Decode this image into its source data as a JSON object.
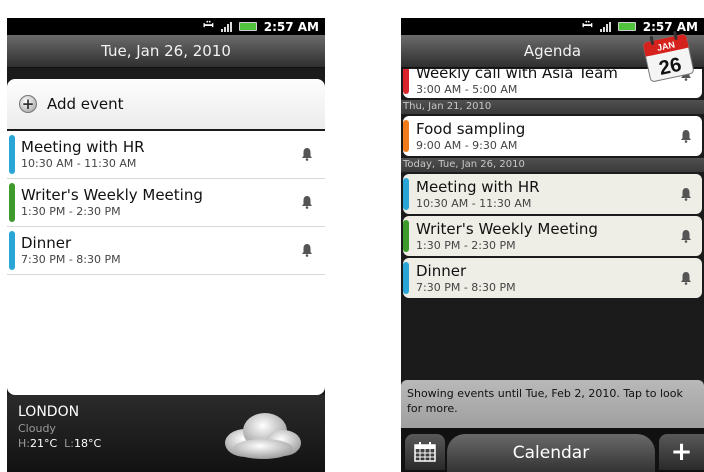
{
  "left": {
    "status_time": "2:57 AM",
    "date_title": "Tue, Jan 26, 2010",
    "add_event_label": "Add event",
    "events": [
      {
        "title": "Meeting with HR",
        "time": "10:30 AM - 11:30 AM",
        "color": "#2aa6d6"
      },
      {
        "title": "Writer's Weekly Meeting",
        "time": "1:30 PM - 2:30 PM",
        "color": "#3e9a2c"
      },
      {
        "title": "Dinner",
        "time": "7:30 PM - 8:30 PM",
        "color": "#2aa6d6"
      }
    ],
    "weather": {
      "city": "LONDON",
      "condition": "Cloudy",
      "high_label": "H:",
      "high": "21°C",
      "low_label": "L:",
      "low": "18°C"
    }
  },
  "right": {
    "status_time": "2:57 AM",
    "title": "Agenda",
    "cal_month": "JAN",
    "cal_day": "26",
    "partial_event": {
      "title": "Weekly call with Asia Team",
      "time": "3:00 AM - 5:00 AM",
      "color": "#d8262c"
    },
    "day1_header": "Thu, Jan 21, 2010",
    "day1_events": [
      {
        "title": "Food sampling",
        "time": "9:00 AM - 9:30 AM",
        "color": "#ef7b1b"
      }
    ],
    "today_header": "Today, Tue, Jan 26, 2010",
    "today_events": [
      {
        "title": "Meeting with HR",
        "time": "10:30 AM - 11:30 AM",
        "color": "#2aa6d6"
      },
      {
        "title": "Writer's Weekly Meeting",
        "time": "1:30 PM - 2:30 PM",
        "color": "#3e9a2c"
      },
      {
        "title": "Dinner",
        "time": "7:30 PM - 8:30 PM",
        "color": "#2aa6d6"
      }
    ],
    "footer_note": "Showing events until Tue, Feb 2, 2010. Tap to look for more.",
    "bottom_center_label": "Calendar",
    "bottom_right_label": "+"
  }
}
